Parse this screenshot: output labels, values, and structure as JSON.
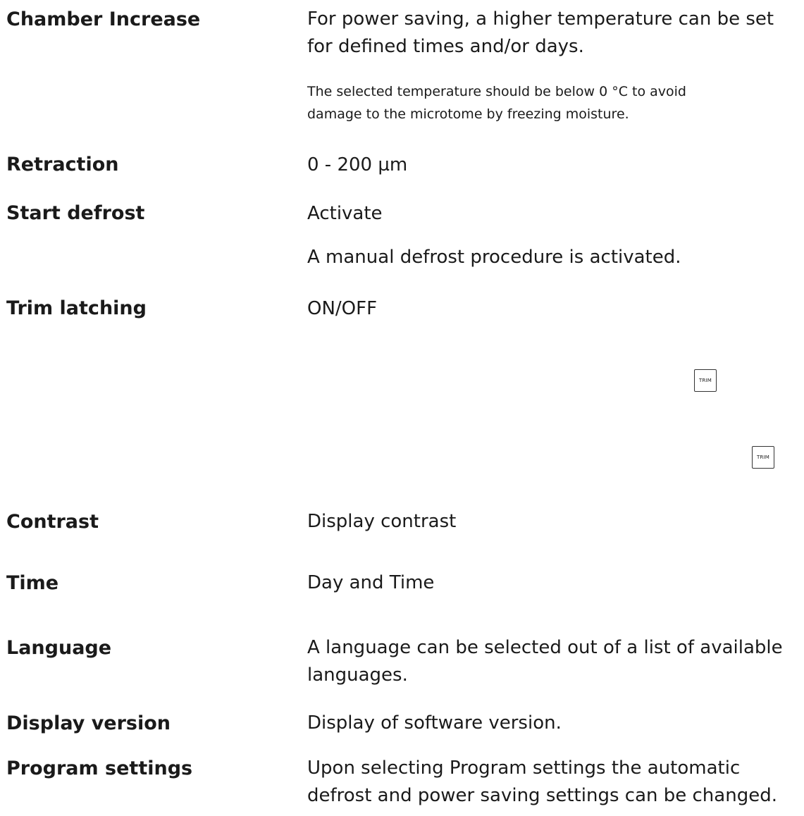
{
  "rows": [
    {
      "term": "Chamber Increase",
      "desc": [
        "For power saving, a higher temperature can be set",
        "for defined times and/or days."
      ],
      "note": [
        "The selected temperature should be below 0 °C to avoid",
        "damage to the microtome by freezing moisture."
      ]
    },
    {
      "term": "Retraction",
      "desc": [
        "0 - 200 µm"
      ]
    },
    {
      "term": "Start defrost",
      "desc": [
        "Activate",
        "A manual defrost procedure is activated."
      ]
    },
    {
      "term": "Trim latching",
      "desc": [
        "ON/OFF"
      ]
    },
    {
      "term": "Contrast",
      "desc": [
        "Display contrast"
      ]
    },
    {
      "term": "Time",
      "desc": [
        "Day and Time"
      ]
    },
    {
      "term": "Language",
      "desc": [
        "A language can be selected out of a list of available",
        "languages."
      ]
    },
    {
      "term": "Display version",
      "desc": [
        "Display of software version."
      ]
    },
    {
      "term": "Program settings",
      "desc": [
        "Upon selecting Program settings the automatic",
        "defrost and power saving settings can be changed."
      ]
    }
  ],
  "trim_keys": [
    "TRIM",
    "TRIM"
  ]
}
